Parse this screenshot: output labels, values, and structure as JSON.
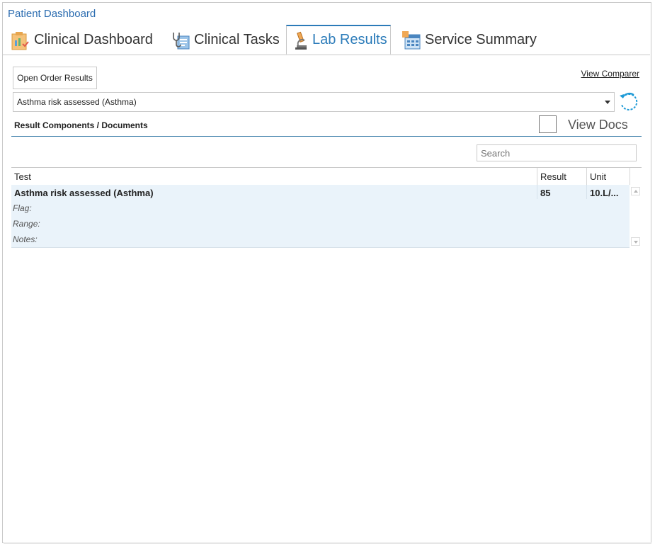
{
  "app": {
    "title": "Patient Dashboard"
  },
  "tabs": [
    {
      "label": "Clinical Dashboard",
      "icon": "clipboard-chart-icon",
      "active": false
    },
    {
      "label": "Clinical Tasks",
      "icon": "stethoscope-tasks-icon",
      "active": false
    },
    {
      "label": "Lab Results",
      "icon": "microscope-icon",
      "active": true
    },
    {
      "label": "Service Summary",
      "icon": "calendar-summary-icon",
      "active": false
    }
  ],
  "toolbar": {
    "open_order_label": "Open Order Results",
    "view_comparer_label": "View Comparer"
  },
  "order_select": {
    "value": "Asthma risk assessed (Asthma)"
  },
  "section": {
    "label": "Result Components / Documents",
    "view_docs_label": "View Docs",
    "view_docs_checked": false
  },
  "search": {
    "placeholder": "Search"
  },
  "grid": {
    "columns": [
      "Test",
      "Result",
      "Unit"
    ],
    "rows": [
      {
        "test": "Asthma risk assessed (Asthma)",
        "result": "85",
        "unit": "10.L/...",
        "flag_label": "Flag:",
        "range_label": "Range:",
        "notes_label": "Notes:"
      }
    ]
  },
  "colors": {
    "accent": "#2b7bb9",
    "row_highlight": "#eaf3fa"
  }
}
